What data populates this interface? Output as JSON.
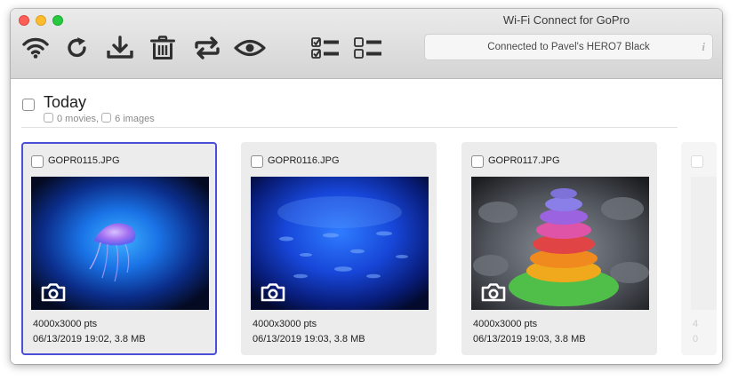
{
  "window": {
    "title": "Wi-Fi Connect for GoPro"
  },
  "toolbar": {
    "buttons": [
      {
        "name": "wifi",
        "icon": "wifi-icon"
      },
      {
        "name": "refresh",
        "icon": "refresh-icon"
      },
      {
        "name": "download",
        "icon": "download-icon"
      },
      {
        "name": "delete",
        "icon": "trash-icon"
      },
      {
        "name": "sync",
        "icon": "swap-arrows-icon"
      },
      {
        "name": "preview",
        "icon": "eye-icon"
      },
      {
        "name": "select-all",
        "icon": "checklist-checked-icon"
      },
      {
        "name": "deselect-all",
        "icon": "checklist-empty-icon"
      }
    ]
  },
  "status": {
    "text": "Connected to Pavel's HERO7 Black",
    "info_glyph": "i"
  },
  "group": {
    "title": "Today",
    "movies_label": "0 movies,",
    "images_label": "6 images"
  },
  "cards": [
    {
      "filename": "GOPR0115.JPG",
      "dimensions": "4000x3000 pts",
      "meta": "06/13/2019 19:02, 3.8 MB",
      "selected": true
    },
    {
      "filename": "GOPR0116.JPG",
      "dimensions": "4000x3000 pts",
      "meta": "06/13/2019 19:03, 3.8 MB",
      "selected": false
    },
    {
      "filename": "GOPR0117.JPG",
      "dimensions": "4000x3000 pts",
      "meta": "06/13/2019 19:03, 3.8 MB",
      "selected": false
    }
  ],
  "partial_card": {
    "dims_fragment": "4",
    "meta_fragment": "0"
  },
  "colors": {
    "selection": "#4a4fd6",
    "card_bg": "#ececec",
    "toolbar_icon": "#2f2f2f"
  }
}
